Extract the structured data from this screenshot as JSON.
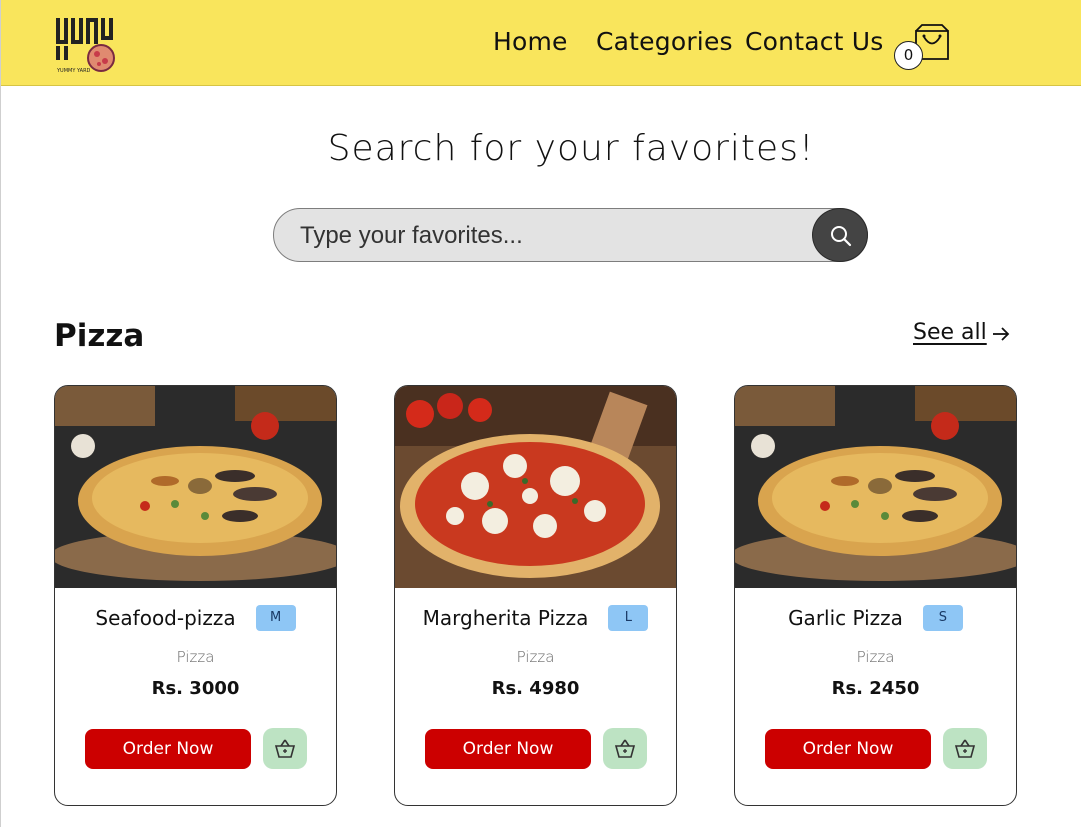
{
  "header": {
    "logo_text": "YUMMY",
    "logo_subtext": "YUMMY YARD",
    "nav": [
      "Home",
      "Categories",
      "Contact Us"
    ],
    "cart_count": "0",
    "cart_icon": "shopping-bag-icon",
    "background_color": "#f9e55c"
  },
  "search": {
    "title": "Search for your favorites!",
    "placeholder": "Type your favorites...",
    "button_icon": "search-icon"
  },
  "section": {
    "title": "Pizza",
    "see_all": "See all",
    "see_all_icon": "arrow-right-icon"
  },
  "products": [
    {
      "name": "Seafood-pizza",
      "size": "M",
      "category": "Pizza",
      "price": "Rs. 3000",
      "order_label": "Order Now",
      "basket_icon": "add-to-basket-icon"
    },
    {
      "name": "Margherita Pizza",
      "size": "L",
      "category": "Pizza",
      "price": "Rs. 4980",
      "order_label": "Order Now",
      "basket_icon": "add-to-basket-icon"
    },
    {
      "name": "Garlic Pizza",
      "size": "S",
      "category": "Pizza",
      "price": "Rs. 2450",
      "order_label": "Order Now",
      "basket_icon": "add-to-basket-icon"
    }
  ],
  "colors": {
    "header": "#f9e55c",
    "order_button": "#cc0000",
    "size_badge": "#8ec6f5",
    "basket_button": "#bde3c3",
    "search_button": "#444444"
  }
}
